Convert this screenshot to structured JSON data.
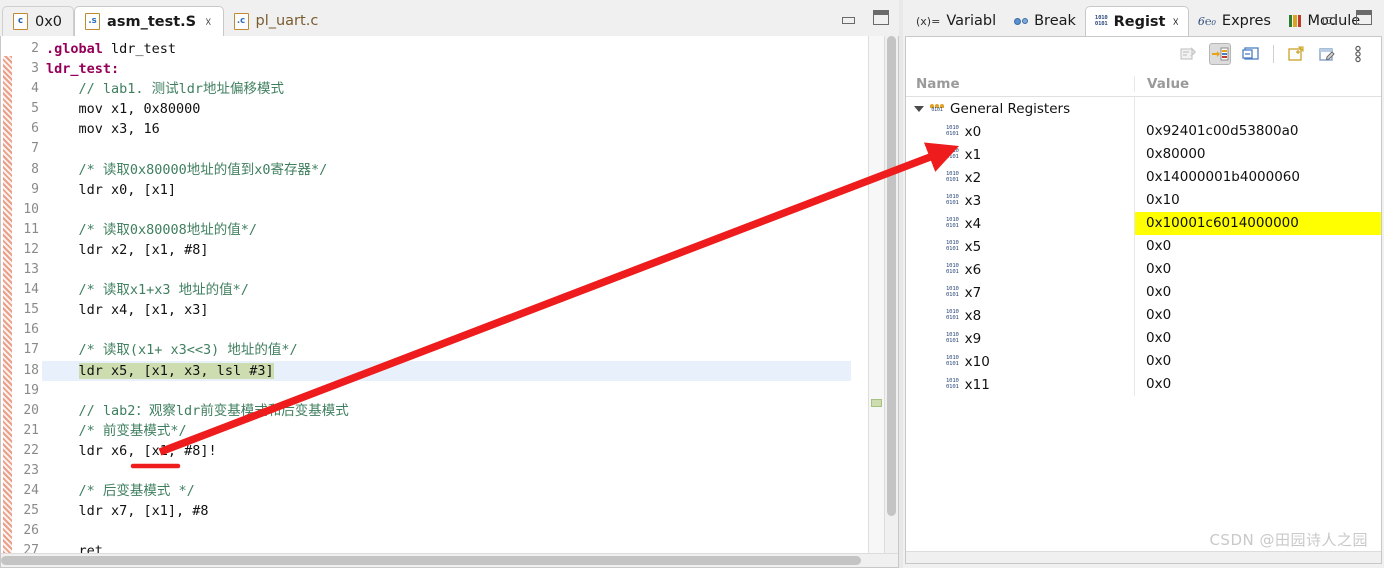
{
  "editor": {
    "tabs": [
      {
        "label": "0x0",
        "icon": "c-file-icon",
        "active": false,
        "closable": false
      },
      {
        "label": "asm_test.S",
        "icon": "asm-file-icon",
        "active": true,
        "closable": true
      },
      {
        "label": "pl_uart.c",
        "icon": "c-file-icon",
        "active": false,
        "closable": false
      }
    ],
    "window_controls": {
      "minimize": "minimize-button",
      "maximize": "maximize-button"
    },
    "current_line": 18,
    "lines": [
      {
        "num": "2",
        "text": ".global ldr_test",
        "type": "keyword-decl"
      },
      {
        "num": "3",
        "text": "ldr_test:",
        "type": "label"
      },
      {
        "num": "4",
        "text": "    // lab1. 测试ldr地址偏移模式",
        "type": "comment"
      },
      {
        "num": "5",
        "text": "    mov x1, 0x80000",
        "type": "code"
      },
      {
        "num": "6",
        "text": "    mov x3, 16",
        "type": "code"
      },
      {
        "num": "7",
        "text": "",
        "type": "blank"
      },
      {
        "num": "8",
        "text": "    /* 读取0x80000地址的值到x0寄存器*/",
        "type": "comment"
      },
      {
        "num": "9",
        "text": "    ldr x0, [x1]",
        "type": "code"
      },
      {
        "num": "10",
        "text": "",
        "type": "blank"
      },
      {
        "num": "11",
        "text": "    /* 读取0x80008地址的值*/",
        "type": "comment"
      },
      {
        "num": "12",
        "text": "    ldr x2, [x1, #8]",
        "type": "code"
      },
      {
        "num": "13",
        "text": "",
        "type": "blank"
      },
      {
        "num": "14",
        "text": "    /* 读取x1+x3 地址的值*/",
        "type": "comment"
      },
      {
        "num": "15",
        "text": "    ldr x4, [x1, x3]",
        "type": "code"
      },
      {
        "num": "16",
        "text": "",
        "type": "blank"
      },
      {
        "num": "17",
        "text": "    /* 读取(x1+ x3<<3) 地址的值*/",
        "type": "comment"
      },
      {
        "num": "18",
        "text": "    ldr x5, [x1, x3, lsl #3]",
        "type": "code-highlighted"
      },
      {
        "num": "19",
        "text": "",
        "type": "blank"
      },
      {
        "num": "20",
        "text": "    // lab2：观察ldr前变基模式和后变基模式",
        "type": "comment"
      },
      {
        "num": "21",
        "text": "    /* 前变基模式*/",
        "type": "comment"
      },
      {
        "num": "22",
        "text": "    ldr x6, [x1, #8]!",
        "type": "code"
      },
      {
        "num": "23",
        "text": "",
        "type": "blank"
      },
      {
        "num": "24",
        "text": "    /* 后变基模式 */",
        "type": "comment"
      },
      {
        "num": "25",
        "text": "    ldr x7, [x1], #8",
        "type": "code"
      },
      {
        "num": "26",
        "text": "",
        "type": "blank"
      },
      {
        "num": "27",
        "text": "    ret",
        "type": "code"
      }
    ]
  },
  "registers_view": {
    "tabs": [
      {
        "label": "Variabl",
        "icon": "variables-icon",
        "active": false,
        "closable": false
      },
      {
        "label": "Break",
        "icon": "breakpoint-icon",
        "active": false,
        "closable": false
      },
      {
        "label": "Regist",
        "icon": "registers-icon",
        "active": true,
        "closable": true
      },
      {
        "label": "Expres",
        "icon": "expressions-icon",
        "active": false,
        "closable": false
      },
      {
        "label": "Module",
        "icon": "modules-icon",
        "active": false,
        "closable": false
      }
    ],
    "toolbar": [
      {
        "name": "collapse-all-button",
        "state": "disabled"
      },
      {
        "name": "show-type-names-button",
        "state": "pressed"
      },
      {
        "name": "show-details-pane-button",
        "state": "normal"
      },
      {
        "name": "add-register-group-button",
        "state": "normal"
      },
      {
        "name": "edit-register-group-button",
        "state": "normal"
      },
      {
        "name": "view-menu-button",
        "state": "normal"
      }
    ],
    "columns": {
      "name": "Name",
      "value": "Value"
    },
    "group": {
      "label": "General Registers",
      "expanded": true
    },
    "rows": [
      {
        "name": "x0",
        "value": "0x92401c00d53800a0",
        "highlighted": false
      },
      {
        "name": "x1",
        "value": "0x80000",
        "highlighted": false
      },
      {
        "name": "x2",
        "value": "0x14000001b4000060",
        "highlighted": false
      },
      {
        "name": "x3",
        "value": "0x10",
        "highlighted": false
      },
      {
        "name": "x4",
        "value": "0x10001c6014000000",
        "highlighted": true
      },
      {
        "name": "x5",
        "value": "0x0",
        "highlighted": false
      },
      {
        "name": "x6",
        "value": "0x0",
        "highlighted": false
      },
      {
        "name": "x7",
        "value": "0x0",
        "highlighted": false
      },
      {
        "name": "x8",
        "value": "0x0",
        "highlighted": false
      },
      {
        "name": "x9",
        "value": "0x0",
        "highlighted": false
      },
      {
        "name": "x10",
        "value": "0x0",
        "highlighted": false
      },
      {
        "name": "x11",
        "value": "0x0",
        "highlighted": false
      }
    ]
  },
  "annotations": {
    "arrow_color": "#ee1c1c",
    "underline_color": "#ee1c1c",
    "arrow_from": "line-22-base-register",
    "arrow_to": "register-x1-row"
  },
  "watermark": {
    "text": "CSDN @田园诗人之园"
  },
  "colors": {
    "keyword": "#96005a",
    "comment": "#3f7f5f",
    "highlight_line_bg": "#e8f0fb",
    "highlight_text_bg": "#cdddb0",
    "value_highlight_bg": "#ffff00",
    "annotation_red": "#ee1c1c"
  }
}
